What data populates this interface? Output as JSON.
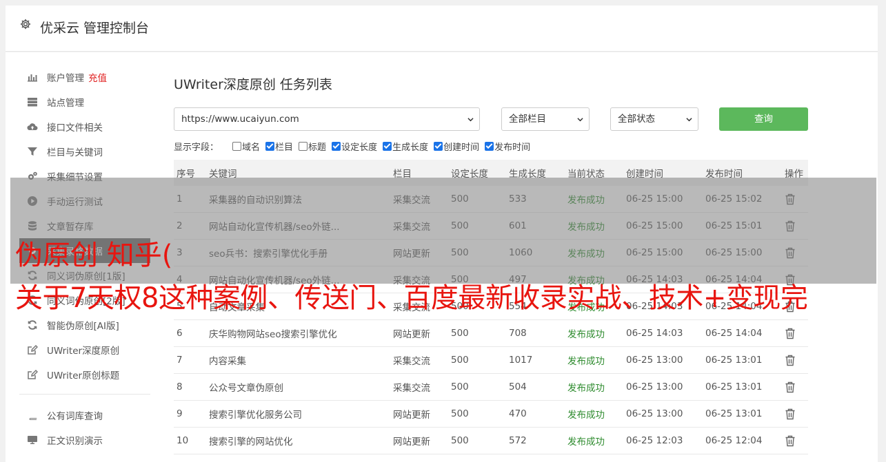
{
  "header": {
    "title": "优采云 管理控制台"
  },
  "sidebar": {
    "items": [
      {
        "label": "账户管理",
        "extra": "充值",
        "icon": "bar-chart-icon"
      },
      {
        "label": "站点管理",
        "icon": "server-icon"
      },
      {
        "label": "接口文件相关",
        "icon": "cloud-upload-icon"
      },
      {
        "label": "栏目与关键词",
        "icon": "filter-icon"
      },
      {
        "label": "采集细节设置",
        "icon": "gears-icon"
      },
      {
        "label": "手动运行测试",
        "icon": "play-circle-icon"
      },
      {
        "label": "文章暂存库",
        "icon": "database-icon"
      },
      {
        "label": "采集录格数据",
        "icon": "gear-icon",
        "active": true
      },
      {
        "label": "同义词伪原创[1版]",
        "icon": "refresh-icon"
      },
      {
        "label": "同义词伪原创[2版]",
        "icon": "refresh-icon"
      },
      {
        "label": "智能伪原创[AI版]",
        "icon": "refresh-icon"
      },
      {
        "label": "UWriter深度原创",
        "icon": "edit-icon"
      },
      {
        "label": "UWriter原创标题",
        "icon": "edit-icon"
      }
    ],
    "items2": [
      {
        "label": "公有词库查询",
        "icon": "book-icon"
      },
      {
        "label": "正文识别演示",
        "icon": "monitor-icon"
      }
    ]
  },
  "main": {
    "title": "UWriter深度原创 任务列表",
    "filters": {
      "site": "https://www.ucaiyun.com",
      "column": "全部栏目",
      "status": "全部状态",
      "query_label": "查询"
    },
    "fields": {
      "label": "显示字段：",
      "options": [
        {
          "label": "域名",
          "checked": false
        },
        {
          "label": "栏目",
          "checked": true
        },
        {
          "label": "标题",
          "checked": false
        },
        {
          "label": "设定长度",
          "checked": true
        },
        {
          "label": "生成长度",
          "checked": true
        },
        {
          "label": "创建时间",
          "checked": true
        },
        {
          "label": "发布时间",
          "checked": true
        }
      ]
    },
    "table": {
      "headers": [
        "序号",
        "关键词",
        "栏目",
        "设定长度",
        "生成长度",
        "当前状态",
        "创建时间",
        "发布时间",
        "操作"
      ],
      "rows": [
        [
          "1",
          "采集器的自动识别算法",
          "采集交流",
          "500",
          "533",
          "发布成功",
          "06-25 15:00",
          "06-25 15:02"
        ],
        [
          "2",
          "网站自动化宣传机器/seo外链...",
          "采集交流",
          "500",
          "601",
          "发布成功",
          "06-25 15:00",
          "06-25 15:01"
        ],
        [
          "3",
          "seo兵书：搜索引擎优化手册",
          "网站更新",
          "500",
          "1060",
          "发布成功",
          "06-25 15:00",
          "06-25 15:00"
        ],
        [
          "4",
          "网站自动化宣传机器/seo外链...",
          "采集交流",
          "500",
          "497",
          "发布成功",
          "06-25 14:03",
          "06-25 14:04"
        ],
        [
          "5",
          "自动文章采集",
          "采集交流",
          "500",
          "554",
          "发布成功",
          "06-25 14:03",
          "06-25 14:04"
        ],
        [
          "6",
          "庆华购物网站seo搜索引擎优化",
          "网站更新",
          "500",
          "708",
          "发布成功",
          "06-25 14:03",
          "06-25 14:04"
        ],
        [
          "7",
          "内容采集",
          "采集交流",
          "500",
          "1017",
          "发布成功",
          "06-25 13:00",
          "06-25 13:01"
        ],
        [
          "8",
          "公众号文章伪原创",
          "采集交流",
          "500",
          "504",
          "发布成功",
          "06-25 13:00",
          "06-25 13:01"
        ],
        [
          "9",
          "搜索引擎优化服务公司",
          "网站更新",
          "500",
          "470",
          "发布成功",
          "06-25 13:00",
          "06-25 13:01"
        ],
        [
          "10",
          "搜索引擎的网站优化",
          "网站更新",
          "500",
          "572",
          "发布成功",
          "06-25 12:03",
          "06-25 12:04"
        ]
      ]
    }
  },
  "overlay": {
    "line1": "伪原创 知乎(",
    "line2": "关于7天权8这种案例、传送门、百度最新收录实战、技术+变现完"
  },
  "colors": {
    "accent": "#5cb85c",
    "status_ok": "#2e8b2e",
    "overlay_text": "#e8150f",
    "recharge": "#e02020"
  }
}
